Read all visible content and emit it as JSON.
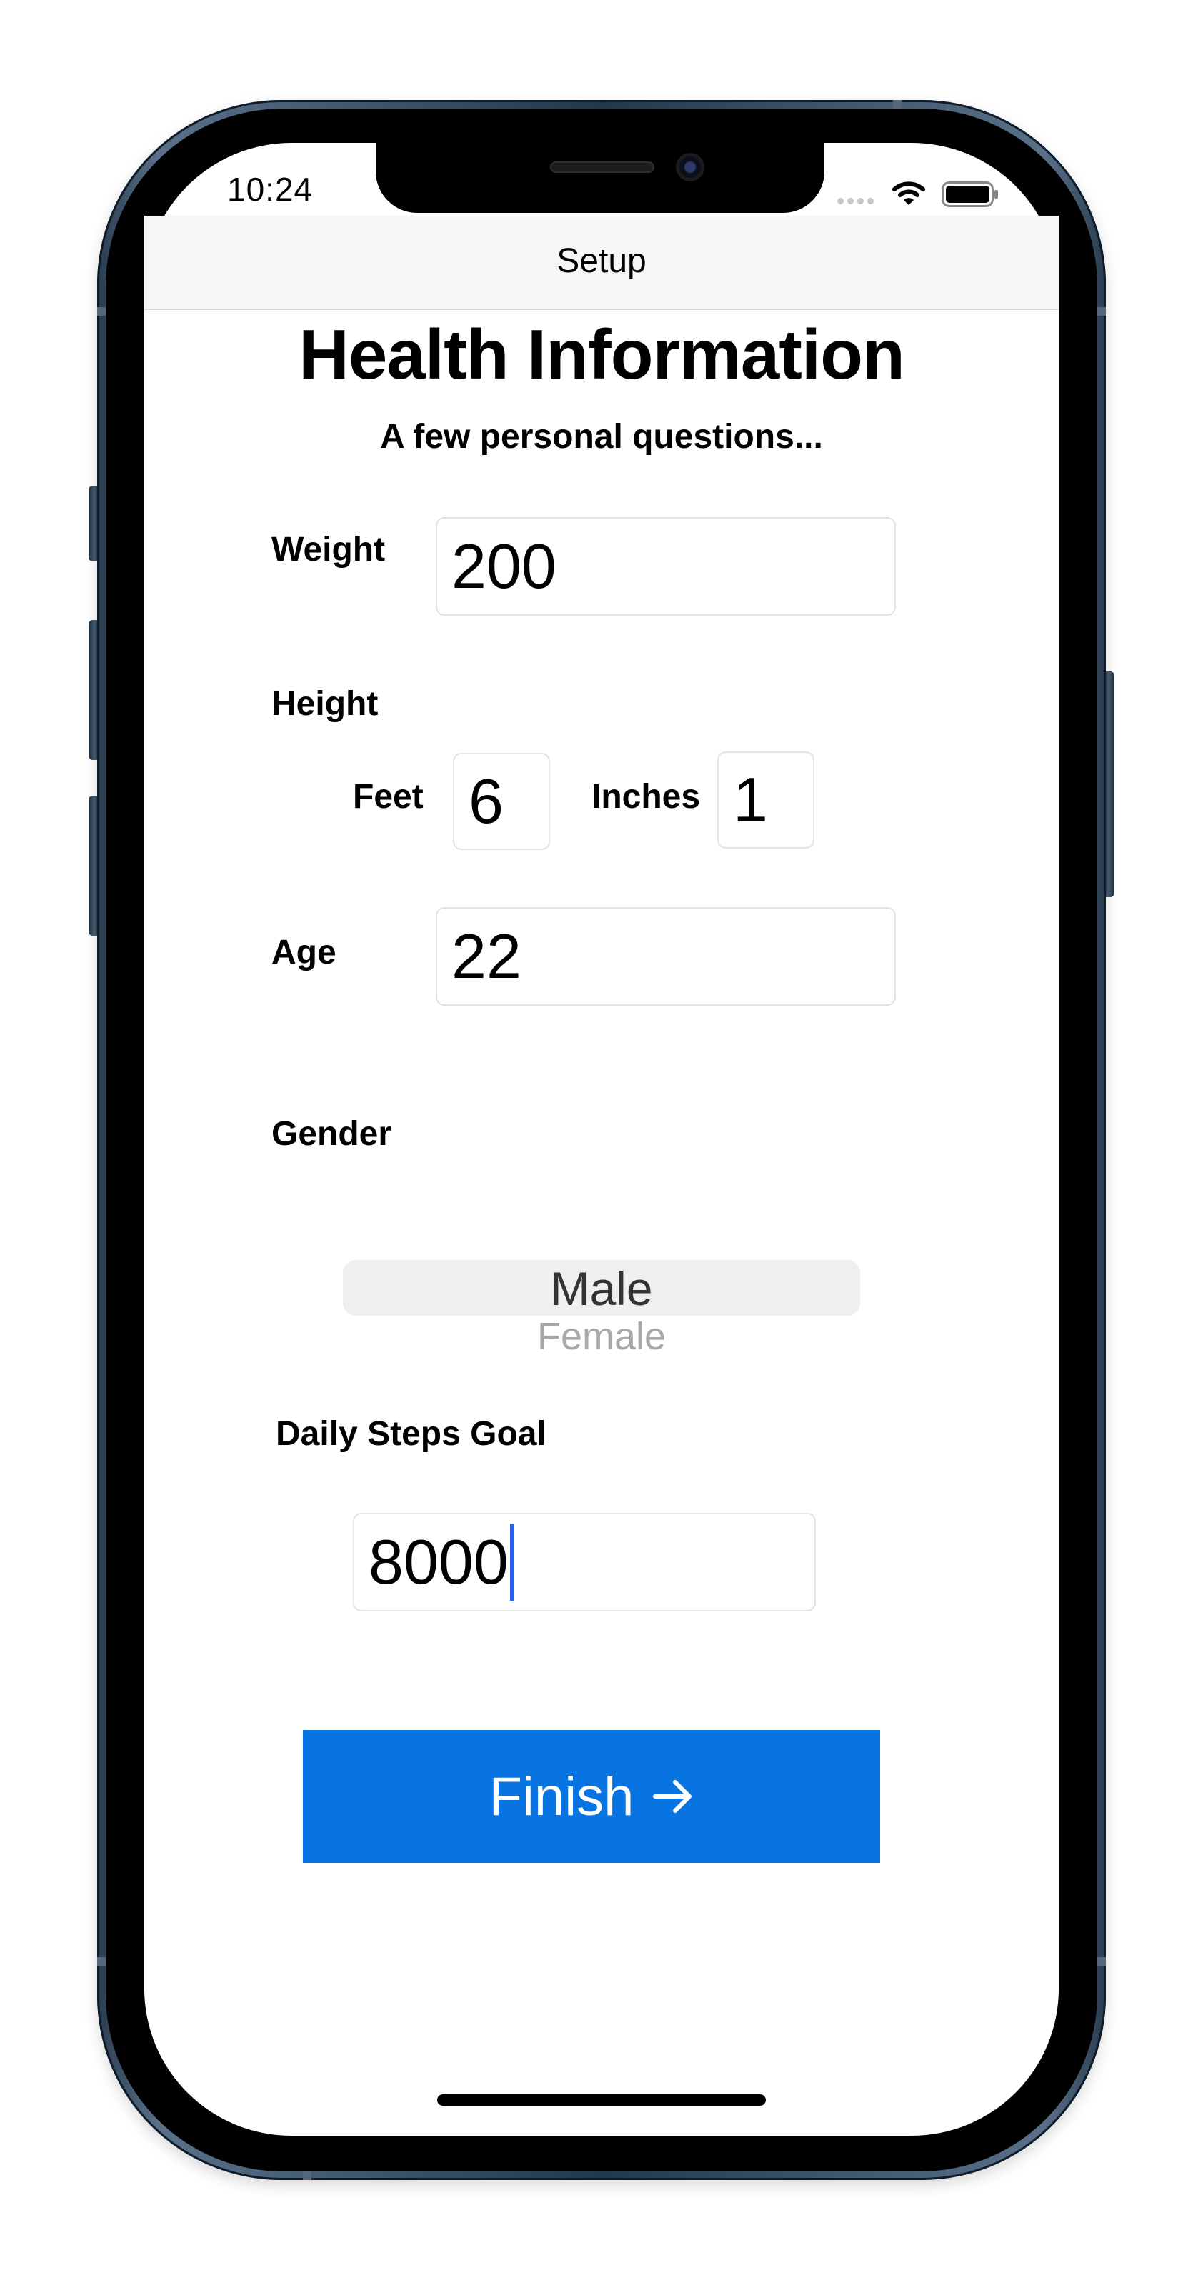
{
  "status_bar": {
    "time": "10:24",
    "icons": [
      "signal-icon",
      "wifi-icon",
      "battery-icon"
    ]
  },
  "nav": {
    "title": "Setup"
  },
  "header": {
    "title": "Health Information",
    "subtitle": "A few personal questions..."
  },
  "form": {
    "weight": {
      "label": "Weight",
      "value": "200"
    },
    "height": {
      "label": "Height",
      "feet_label": "Feet",
      "feet_value": "6",
      "inches_label": "Inches",
      "inches_value": "1"
    },
    "age": {
      "label": "Age",
      "value": "22"
    },
    "gender": {
      "label": "Gender",
      "options": [
        "Male",
        "Female"
      ],
      "selected": "Male"
    },
    "steps": {
      "label": "Daily Steps Goal",
      "value": "8000"
    }
  },
  "actions": {
    "finish_label": "Finish",
    "finish_icon": "arrow-right-icon",
    "accent_color": "#0874e2"
  }
}
